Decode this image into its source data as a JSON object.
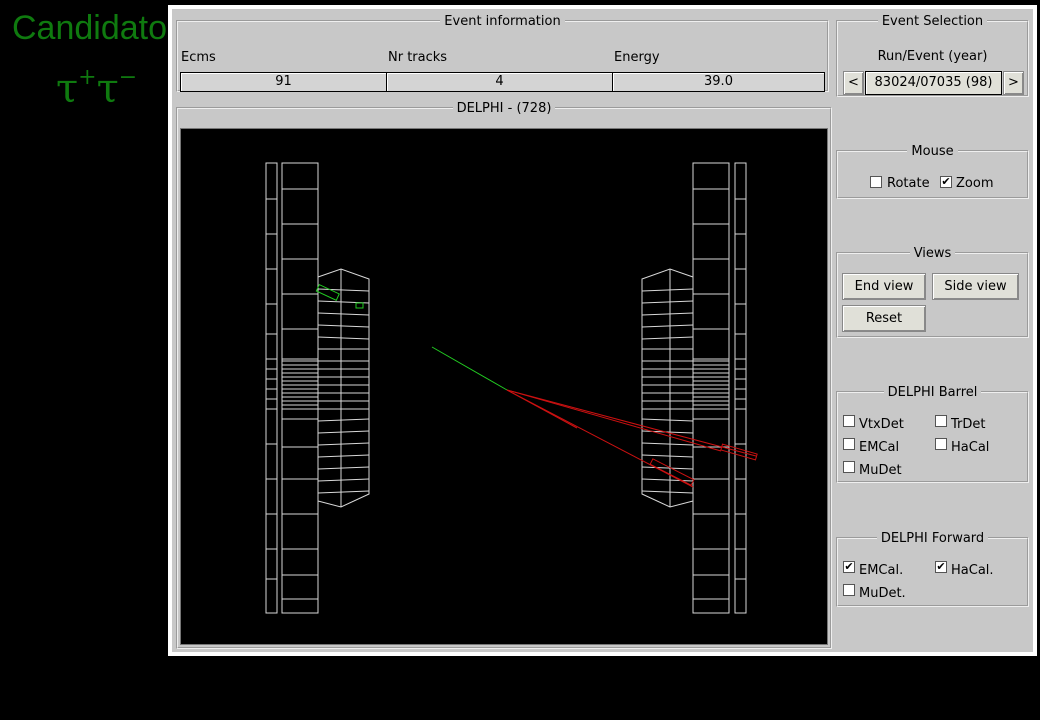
{
  "slide": {
    "title": "Candidato",
    "subtitle_base": "τ",
    "sup_plus": "+",
    "sup_minus": "−"
  },
  "event_info": {
    "legend": "Event information",
    "fields": [
      {
        "label": "Ecms",
        "value": "91"
      },
      {
        "label": "Nr tracks",
        "value": "4"
      },
      {
        "label": "Energy",
        "value": "39.0"
      }
    ]
  },
  "event_selection": {
    "legend": "Event Selection",
    "caption": "Run/Event  (year)",
    "prev_label": "<",
    "next_label": ">",
    "run_event": "83024/07035   (98)"
  },
  "display": {
    "legend": "DELPHI - (728)"
  },
  "mouse": {
    "legend": "Mouse",
    "options": [
      {
        "label": "Rotate",
        "checked": false
      },
      {
        "label": "Zoom",
        "checked": true
      }
    ]
  },
  "views": {
    "legend": "Views",
    "end_view": "End view",
    "side_view": "Side view",
    "reset": "Reset"
  },
  "barrel": {
    "legend": "DELPHI Barrel",
    "options": [
      {
        "label": "VtxDet",
        "checked": false
      },
      {
        "label": "TrDet",
        "checked": false
      },
      {
        "label": "EMCal",
        "checked": false
      },
      {
        "label": "HaCal",
        "checked": false
      },
      {
        "label": "MuDet",
        "checked": false
      }
    ]
  },
  "forward": {
    "legend": "DELPHI Forward",
    "options": [
      {
        "label": "EMCal.",
        "checked": true
      },
      {
        "label": "HaCal.",
        "checked": true
      },
      {
        "label": "MuDet.",
        "checked": false
      }
    ]
  },
  "colors": {
    "title_green": "#0f7a0f",
    "track_green": "#22cc22",
    "track_red": "#cc1111",
    "panel": "#c8c8c8"
  },
  "check_glyph": "✔"
}
